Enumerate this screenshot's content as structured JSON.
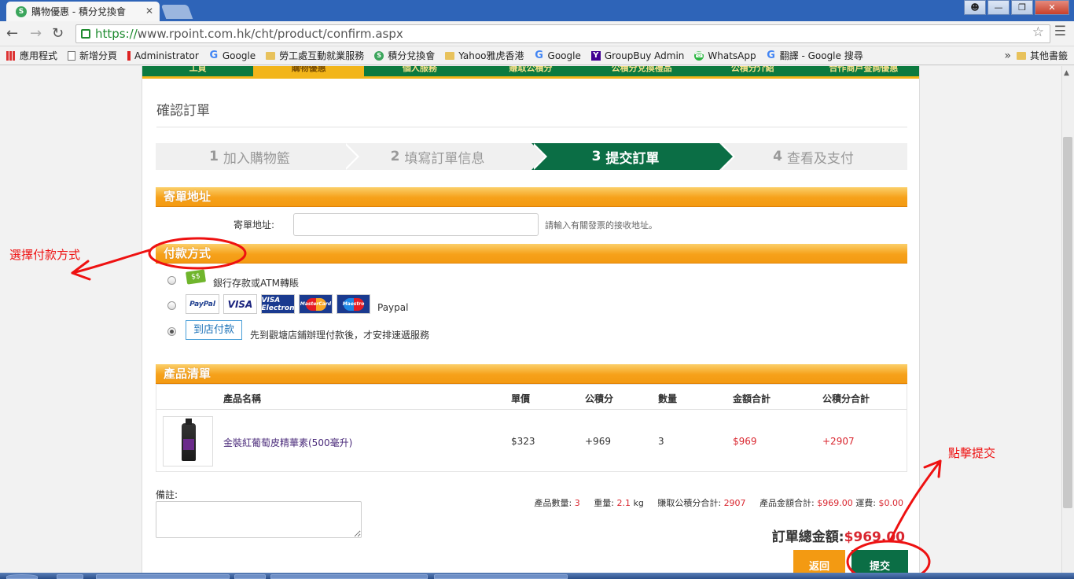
{
  "browser": {
    "tab_title": "購物優惠 - 積分兌換會",
    "tab_close": "✕",
    "favicon": "S",
    "url_scheme": "https://",
    "url_rest": "www.rpoint.com.hk/cht/product/confirm.aspx",
    "bookmarks": [
      {
        "label": "應用程式",
        "icon": "apps-icon"
      },
      {
        "label": "新增分頁",
        "icon": "page-icon"
      },
      {
        "label": "Administrator",
        "icon": "bar-icon"
      },
      {
        "label": "Google",
        "icon": "google-icon"
      },
      {
        "label": "勞工處互動就業服務",
        "icon": "folder-icon"
      },
      {
        "label": "積分兌換會",
        "icon": "site-icon"
      },
      {
        "label": "Yahoo雅虎香港",
        "icon": "folder-icon"
      },
      {
        "label": "Google",
        "icon": "google-icon"
      },
      {
        "label": "GroupBuy Admin",
        "icon": "yahoo-icon"
      },
      {
        "label": "WhatsApp",
        "icon": "whatsapp-icon"
      },
      {
        "label": "翻譯 - Google 搜尋",
        "icon": "google-icon"
      }
    ],
    "bookmarks_more": "»",
    "other_bookmarks": "其他書籤"
  },
  "nav": {
    "items": [
      "工頁",
      "購物優惠",
      "個人服務",
      "賺取公積分",
      "公積分兌換禮品",
      "公積分介紹",
      "合作商戶查詢優惠"
    ],
    "active_index": 1
  },
  "page": {
    "title": "確認訂單",
    "steps": [
      {
        "num": "1",
        "label": "加入購物籃"
      },
      {
        "num": "2",
        "label": "填寫訂單信息"
      },
      {
        "num": "3",
        "label": "提交訂單"
      },
      {
        "num": "4",
        "label": "查看及支付"
      }
    ],
    "active_step": 2
  },
  "shipping": {
    "heading": "寄單地址",
    "label": "寄單地址:",
    "value": "",
    "hint": "請輸入有關發票的接收地址。"
  },
  "payment": {
    "heading": "付款方式",
    "bank_icon_text": "$$",
    "bank_label": "銀行存款或ATM轉賬",
    "cards": [
      "PayPal",
      "VISA",
      "VISA Electron",
      "MasterCard",
      "Maestro"
    ],
    "paypal_label": "Paypal",
    "store_badge": "到店付款",
    "store_label": "先到觀塘店鋪辦理付款後，才安排速遞服務",
    "selected": "store"
  },
  "products": {
    "heading": "產品清單",
    "columns": [
      "產品名稱",
      "單價",
      "公積分",
      "數量",
      "金額合計",
      "公積分合計"
    ],
    "rows": [
      {
        "name": "金裝紅葡萄皮精華素(500毫升)",
        "price": "$323",
        "points": "+969",
        "qty": "3",
        "amount": "$969",
        "points_total": "+2907"
      }
    ]
  },
  "order": {
    "notes_label": "備註:",
    "notes_value": "",
    "qty_label": "產品數量:",
    "qty_value": "3",
    "weight_label": "重量:",
    "weight_value": "2.1",
    "weight_unit": "kg",
    "earn_label": "賺取公積分合計:",
    "earn_value": "2907",
    "amount_label": "產品金額合計:",
    "amount_value": "$969.00",
    "shipping_label": "運費:",
    "shipping_value": "$0.00",
    "total_label": "訂單總金額:",
    "total_value": "$969.00",
    "back_button": "返回",
    "submit_button": "提交"
  },
  "annotations": {
    "left_note": "選擇付款方式",
    "right_note": "點擊提交",
    "color": "#e11111"
  }
}
